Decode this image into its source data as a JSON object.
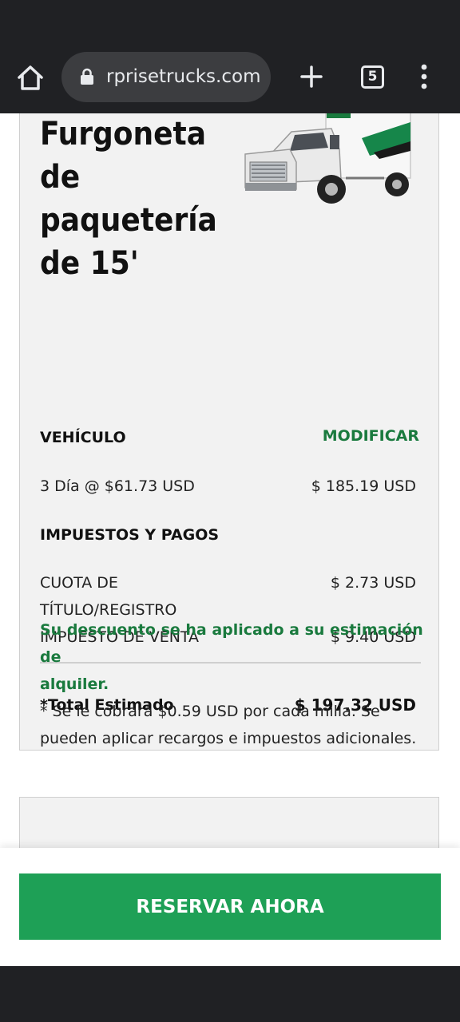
{
  "browser": {
    "url": "rprisetrucks.com",
    "tab_count": "5"
  },
  "vehicle": {
    "title": "Furgoneta de paquetería de 15'",
    "image_alt": "box-truck"
  },
  "summary": {
    "vehicle_header": "VEHÍCULO",
    "modify_label": "MODIFICAR",
    "rate_label": "3 Día @ $61.73 USD",
    "rate_amount": "$ 185.19 USD",
    "taxes_header": "IMPUESTOS Y PAGOS",
    "fee_label_line1": "CUOTA DE",
    "fee_label_line2": "TÍTULO/REGISTRO",
    "fee_amount": "$ 2.73 USD",
    "sales_tax_label": "IMPUESTO DE VENTA",
    "sales_tax_amount": "$ 9.40 USD",
    "total_label": "*Total Estimado",
    "total_amount": "$ 197.32 USD",
    "discount_line1": "Su descuento se ha aplicado a su estimación de",
    "discount_line2": "alquiler.",
    "note_line1": "* Se le cobrará $0.59 USD por cada milla. Se",
    "note_line2": "pueden aplicar recargos e impuestos adicionales."
  },
  "footer": {
    "reserve_label": "RESERVAR AHORA"
  },
  "colors": {
    "accent_green": "#1a7a3e",
    "button_green": "#1ea056",
    "chrome_dark": "#202124"
  }
}
